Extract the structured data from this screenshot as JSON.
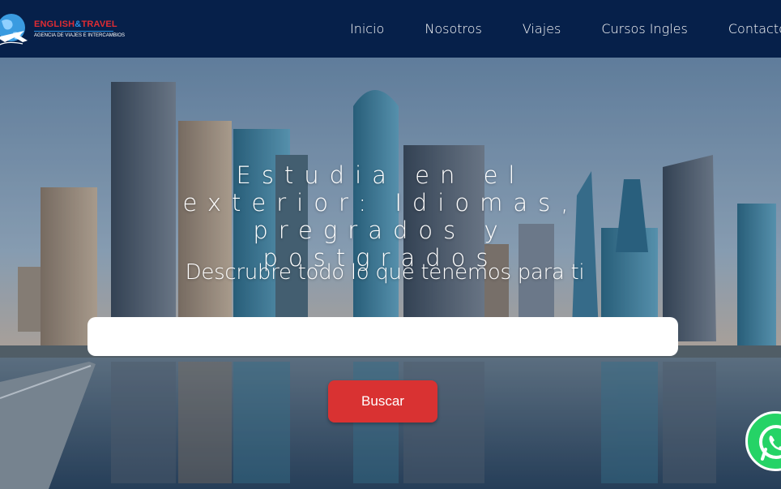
{
  "logo": {
    "title_part1": "ENGLISH",
    "title_amp": "&",
    "title_part2": "TRAVEL",
    "subtitle": "AGENCIA DE VIAJES E INTERCAMBIOS",
    "icon": "globe-plane-icon"
  },
  "nav": {
    "items": [
      {
        "label": "Inicio"
      },
      {
        "label": "Nosotros"
      },
      {
        "label": "Viajes"
      },
      {
        "label": "Cursos Ingles"
      },
      {
        "label": "Contacto"
      }
    ]
  },
  "hero": {
    "title": "Estudia en el exterior: Idiomas, pregrados y postgrados",
    "subtitle": "Descrubre todo lo que tenemos para ti",
    "search": {
      "value": "",
      "placeholder": ""
    },
    "button_label": "Buscar"
  },
  "whatsapp": {
    "icon": "whatsapp-icon"
  },
  "colors": {
    "nav_bg": "#06204a",
    "button": "#d93232",
    "whatsapp": "#25d366",
    "logo_red": "#e02c33",
    "logo_blue": "#2c8fe0"
  }
}
